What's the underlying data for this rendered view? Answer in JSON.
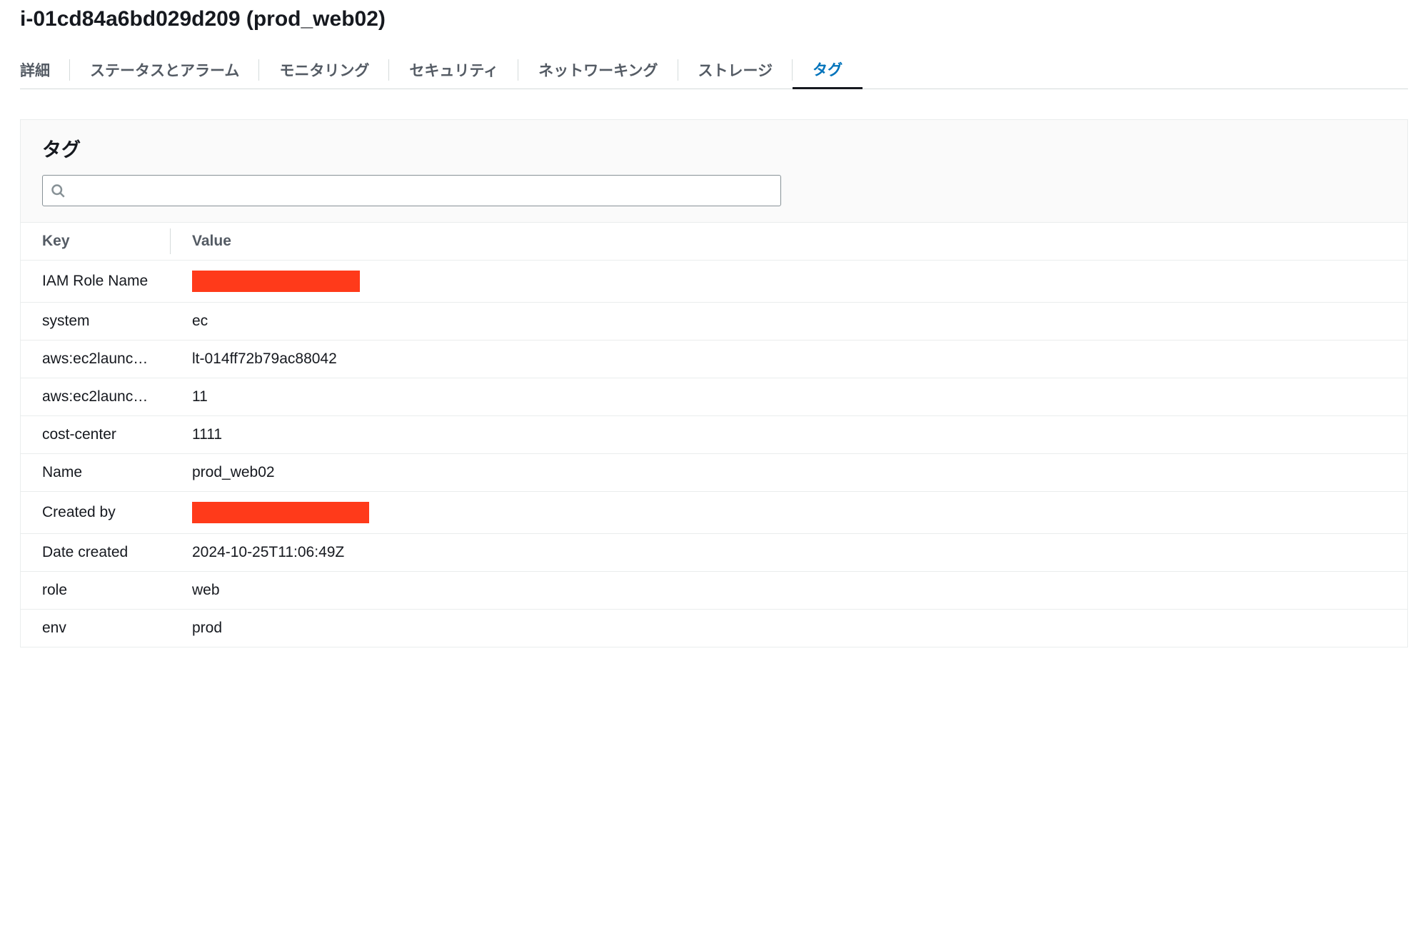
{
  "header": {
    "title": "i-01cd84a6bd029d209 (prod_web02)"
  },
  "tabs": {
    "items": [
      {
        "label": "詳細",
        "active": false
      },
      {
        "label": "ステータスとアラーム",
        "active": false
      },
      {
        "label": "モニタリング",
        "active": false
      },
      {
        "label": "セキュリティ",
        "active": false
      },
      {
        "label": "ネットワーキング",
        "active": false
      },
      {
        "label": "ストレージ",
        "active": false
      },
      {
        "label": "タグ",
        "active": true
      }
    ]
  },
  "panel": {
    "title": "タグ",
    "search_placeholder": ""
  },
  "table": {
    "columns": {
      "key": "Key",
      "value": "Value"
    },
    "rows": [
      {
        "key": "IAM Role Name",
        "value": "",
        "redacted": true,
        "redactClass": "w1"
      },
      {
        "key": "system",
        "value": "ec"
      },
      {
        "key": "aws:ec2launc…",
        "value": "lt-014ff72b79ac88042"
      },
      {
        "key": "aws:ec2launc…",
        "value": "11"
      },
      {
        "key": "cost-center",
        "value": "1111"
      },
      {
        "key": "Name",
        "value": "prod_web02"
      },
      {
        "key": "Created by",
        "value": "",
        "redacted": true,
        "redactClass": "w2"
      },
      {
        "key": "Date created",
        "value": "2024-10-25T11:06:49Z"
      },
      {
        "key": "role",
        "value": "web"
      },
      {
        "key": "env",
        "value": "prod"
      }
    ]
  }
}
